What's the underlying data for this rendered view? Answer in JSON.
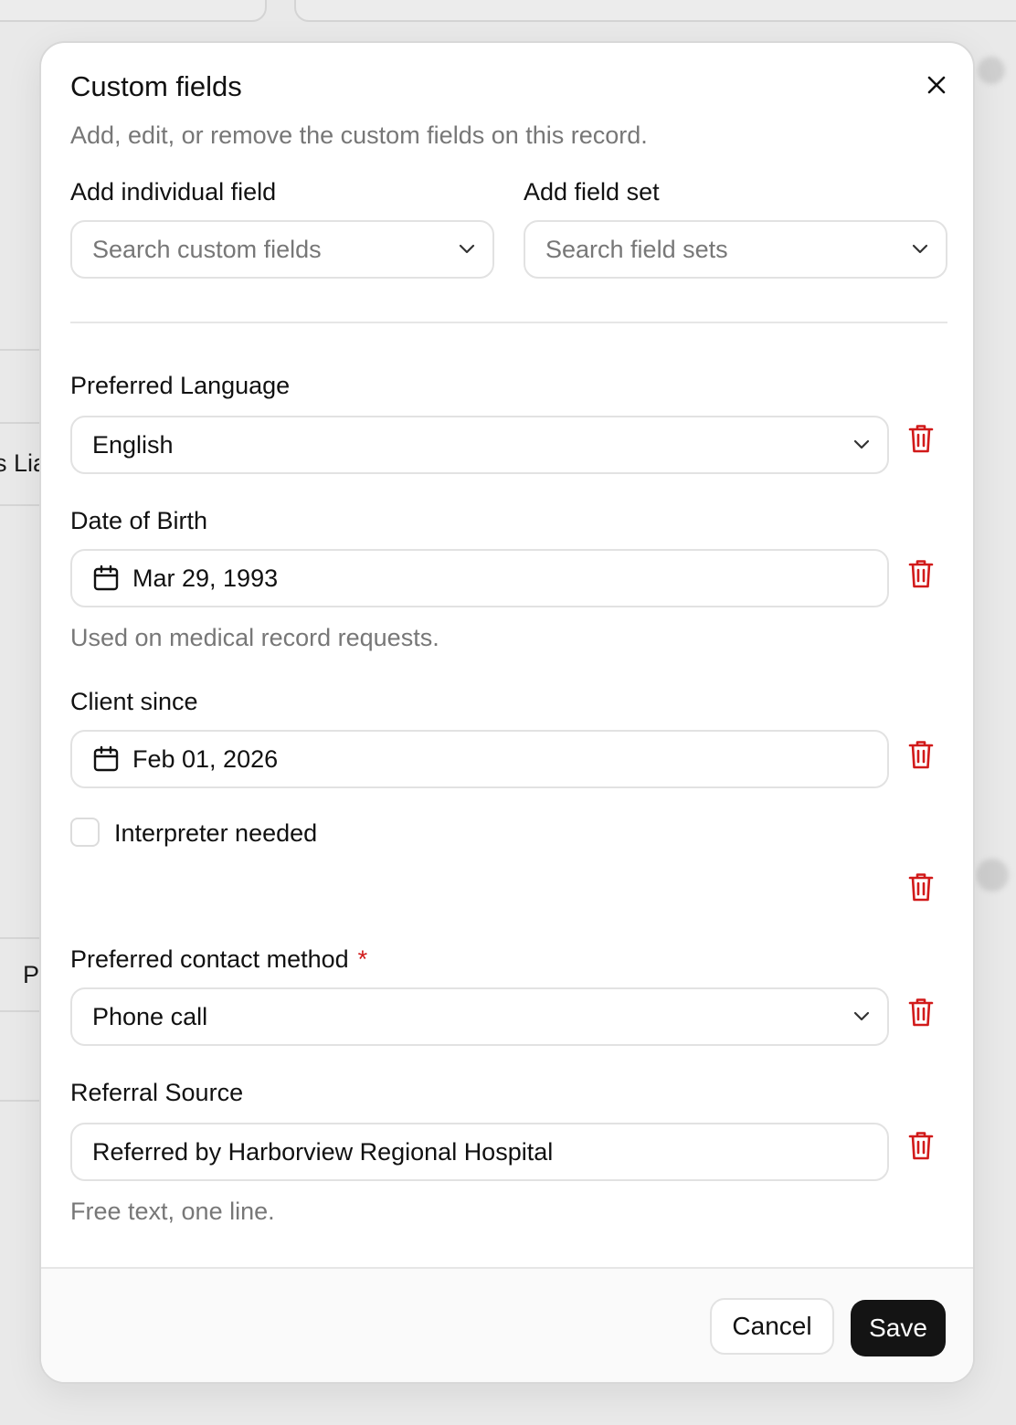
{
  "background": {
    "partial_texts": [
      "s Lia",
      "P"
    ]
  },
  "modal": {
    "title": "Custom fields",
    "subtitle": "Add, edit, or remove the custom fields on this record.",
    "add_individual": {
      "label": "Add individual field",
      "placeholder": "Search custom fields"
    },
    "add_set": {
      "label": "Add field set",
      "placeholder": "Search field sets"
    },
    "fields": {
      "language": {
        "label": "Preferred Language",
        "value": "English"
      },
      "dob": {
        "label": "Date of Birth",
        "value": "Mar 29, 1993",
        "help": "Used on medical record requests."
      },
      "client_since": {
        "label": "Client since",
        "value": "Feb 01, 2026"
      },
      "interpreter": {
        "label": "Interpreter needed",
        "checked": false
      },
      "contact": {
        "label": "Preferred contact method",
        "required_mark": "*",
        "value": "Phone call"
      },
      "referral": {
        "label": "Referral Source",
        "value": "Referred by Harborview Regional Hospital",
        "help": "Free text, one line."
      }
    },
    "footer": {
      "cancel_label": "Cancel",
      "save_label": "Save"
    }
  },
  "icons": {
    "close": "close-icon",
    "chevron": "chevron-down-icon",
    "calendar": "calendar-icon",
    "trash": "trash-icon"
  },
  "colors": {
    "danger": "#d11a1a",
    "primary_button": "#141414",
    "muted_text": "#777777",
    "border": "#e2e2e2"
  }
}
